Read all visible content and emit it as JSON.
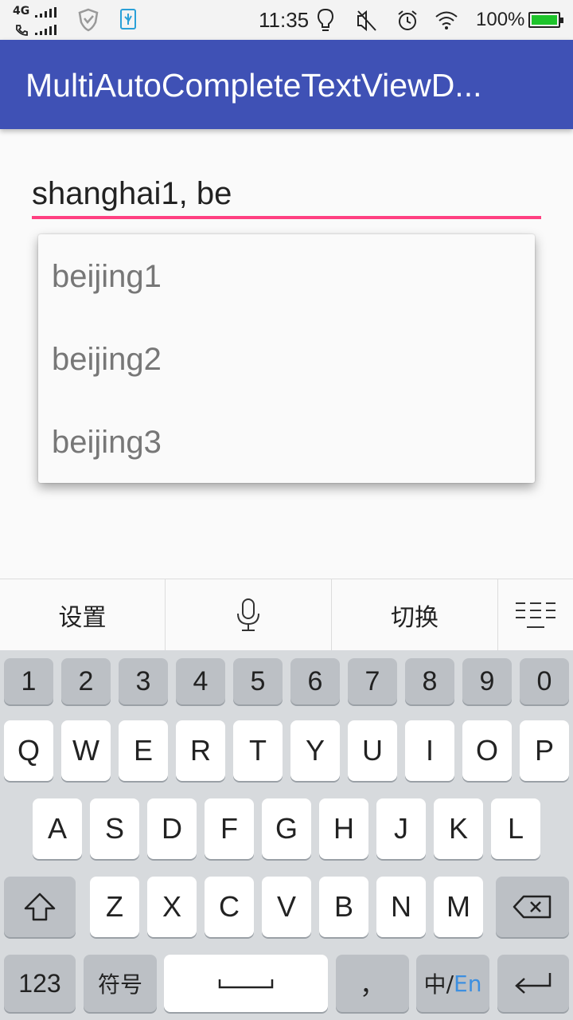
{
  "status_bar": {
    "network": "4G",
    "time": "11:35",
    "battery": "100%",
    "icons": [
      "signal-icon",
      "call-signal-icon",
      "shield-icon",
      "usb-icon",
      "bulb-icon",
      "mute-icon",
      "alarm-icon",
      "wifi-icon",
      "battery-icon"
    ]
  },
  "app_bar": {
    "title": "MultiAutoCompleteTextViewD...",
    "color": "#3f51b5"
  },
  "input": {
    "value": "shanghai1, be",
    "underline_color": "#ff4081"
  },
  "dropdown": {
    "items": [
      "beijing1",
      "beijing2",
      "beijing3"
    ]
  },
  "keyboard_toolbar": {
    "settings_label": "设置",
    "switch_label": "切换",
    "icons": [
      "microphone-icon",
      "keyboard-layout-icon"
    ]
  },
  "keyboard": {
    "number_row": [
      "1",
      "2",
      "3",
      "4",
      "5",
      "6",
      "7",
      "8",
      "9",
      "0"
    ],
    "row1": [
      "Q",
      "W",
      "E",
      "R",
      "T",
      "Y",
      "U",
      "I",
      "O",
      "P"
    ],
    "row2": [
      "A",
      "S",
      "D",
      "F",
      "G",
      "H",
      "J",
      "K",
      "L"
    ],
    "row3": [
      "Z",
      "X",
      "C",
      "V",
      "B",
      "N",
      "M"
    ],
    "mode_123": "123",
    "symbols": "符号",
    "comma": "，",
    "lang_zh": "中",
    "lang_sep": "/",
    "lang_en": "En"
  }
}
